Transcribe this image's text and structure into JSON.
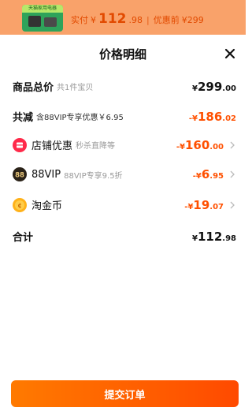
{
  "top": {
    "thumb_band": "天猫家用电器",
    "paid_label": "实付",
    "paid_currency": "¥",
    "paid_int": "112",
    "paid_dec": ".98",
    "separator": "|",
    "before_label": "优惠前",
    "before_price": "¥299"
  },
  "sheet": {
    "title": "价格明细",
    "rows": [
      {
        "label": "商品总价",
        "sub": "共1件宝贝",
        "currency": "¥",
        "int": "299",
        "dec": ".00"
      },
      {
        "label": "共减",
        "sub": "含88VIP专享优惠￥6.95",
        "currency": "-¥",
        "int": "186",
        "dec": ".02"
      },
      {
        "label": "店铺优惠",
        "sub": "秒杀直降等",
        "currency": "-¥",
        "int": "160",
        "dec": ".00"
      },
      {
        "label": "88VIP",
        "sub": "88VIP专享9.5折",
        "currency": "-¥",
        "int": "6",
        "dec": ".95"
      },
      {
        "label": "淘金币",
        "sub": "",
        "currency": "-¥",
        "int": "19",
        "dec": ".07"
      },
      {
        "label": "合计",
        "sub": "",
        "currency": "¥",
        "int": "112",
        "dec": ".98"
      }
    ],
    "submit_label": "提交订单"
  },
  "icons": {
    "store": "store-coupon-icon",
    "vip": "vip-88-icon",
    "coin": "taojinbi-coin-icon",
    "close": "close-icon",
    "chevron": "chevron-right-icon"
  },
  "colors": {
    "accent": "#ff5000",
    "top_bg": "#f9a26a",
    "text": "#111111",
    "muted": "#999999"
  }
}
